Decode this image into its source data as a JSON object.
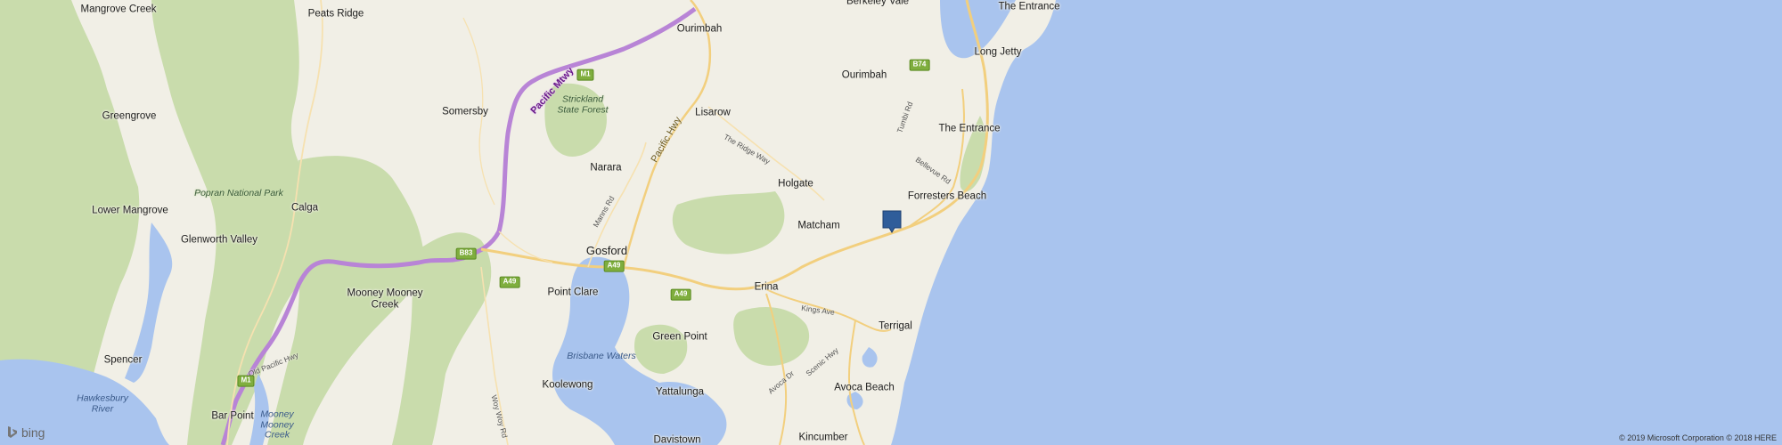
{
  "map": {
    "provider_logo": "bing",
    "copyright": "© 2019 Microsoft Corporation © 2018 HERE",
    "colors": {
      "sea": "#a9c4ee",
      "land": "#f1efe6",
      "forest": "#c9dcac",
      "inlet": "#a9c4ee",
      "motorway": "#b884d6",
      "primary_road": "#f2cf7e",
      "marker": "#2f5d9a"
    },
    "marker": {
      "icon": "location-pin-icon"
    },
    "places": [
      {
        "name": "Mangrove Creek"
      },
      {
        "name": "Peats Ridge"
      },
      {
        "name": "Ourimbah"
      },
      {
        "name": "Berkeley Vale"
      },
      {
        "name": "The Entrance"
      },
      {
        "name": "Long Jetty"
      },
      {
        "name": "Ourimbah"
      },
      {
        "name": "Somersby"
      },
      {
        "name": "Greengrove"
      },
      {
        "name": "Lisarow"
      },
      {
        "name": "The Entrance"
      },
      {
        "name": "Narara"
      },
      {
        "name": "Holgate"
      },
      {
        "name": "Forresters Beach"
      },
      {
        "name": "Lower Mangrove"
      },
      {
        "name": "Calga"
      },
      {
        "name": "Matcham"
      },
      {
        "name": "Glenworth Valley"
      },
      {
        "name": "Gosford"
      },
      {
        "name": "Erina"
      },
      {
        "name": "Mooney Mooney Creek"
      },
      {
        "name": "Point Clare"
      },
      {
        "name": "Terrigal"
      },
      {
        "name": "Green Point"
      },
      {
        "name": "Spencer"
      },
      {
        "name": "Koolewong"
      },
      {
        "name": "Avoca Beach"
      },
      {
        "name": "Bar Point"
      },
      {
        "name": "Yattalunga"
      },
      {
        "name": "Davistown"
      },
      {
        "name": "Kincumber"
      }
    ],
    "parks": [
      {
        "name": "Strickland State Forest"
      },
      {
        "name": "Popran National Park"
      }
    ],
    "water_labels": [
      {
        "name": "Brisbane Waters"
      },
      {
        "name": "Hawkesbury River"
      },
      {
        "name": "Mooney Mooney Creek"
      }
    ],
    "road_labels": [
      {
        "name": "Pacific Mtwy"
      },
      {
        "name": "Pacific Hwy"
      },
      {
        "name": "The Ridge Way"
      },
      {
        "name": "Manns Rd"
      },
      {
        "name": "Bellevue Rd"
      },
      {
        "name": "Kings Ave"
      },
      {
        "name": "Scenic Hwy"
      },
      {
        "name": "Avoca Dr"
      },
      {
        "name": "Woy Woy Rd"
      },
      {
        "name": "Old Pacific Hwy"
      },
      {
        "name": "Tumbi Rd"
      }
    ],
    "shields": [
      {
        "code": "M1"
      },
      {
        "code": "B74"
      },
      {
        "code": "B83"
      },
      {
        "code": "A49"
      },
      {
        "code": "A49"
      },
      {
        "code": "A49"
      },
      {
        "code": "M1"
      }
    ]
  }
}
